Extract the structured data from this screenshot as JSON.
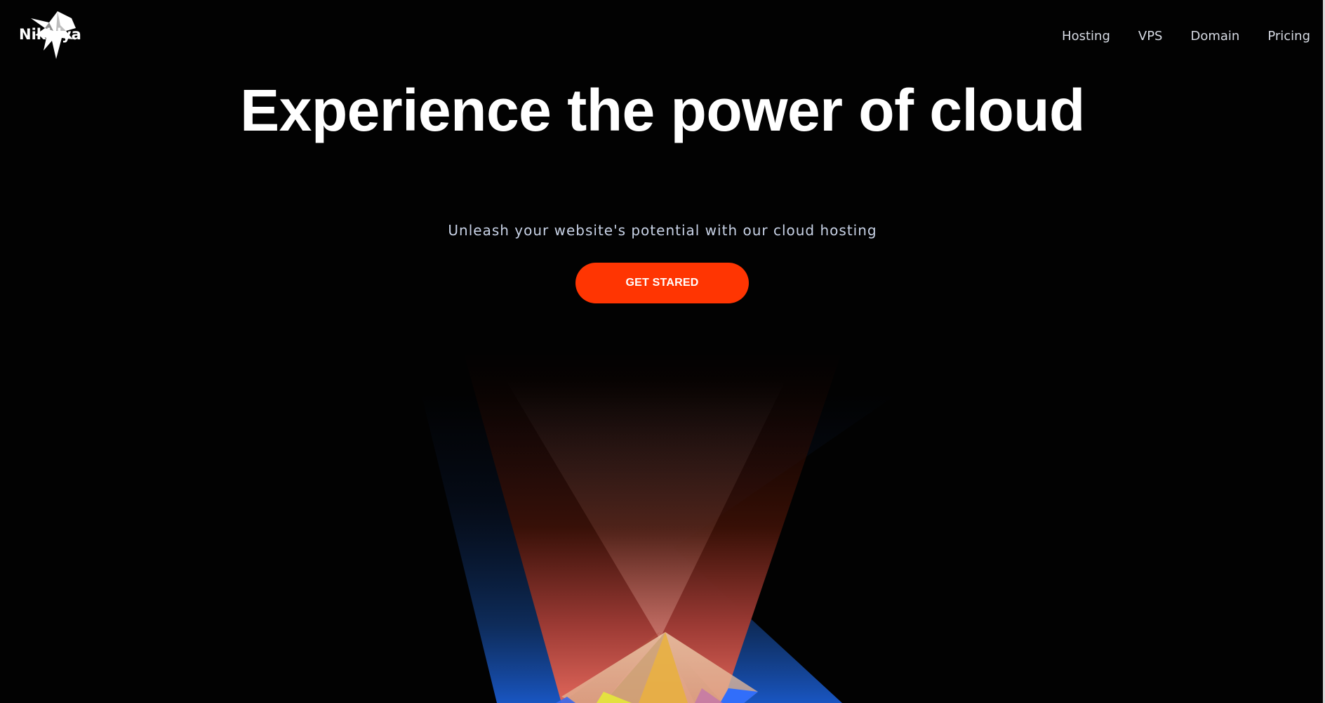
{
  "brand": {
    "name": "Nikhlya",
    "logo_icon": "star-burst-logo-icon"
  },
  "nav": {
    "items": [
      {
        "label": "Hosting"
      },
      {
        "label": "VPS"
      },
      {
        "label": "Domain"
      },
      {
        "label": "Pricing"
      }
    ]
  },
  "hero": {
    "title": "Experience the power of cloud",
    "subtitle": "Unleash your website's potential with our cloud hosting",
    "cta_label": "GET STARED"
  },
  "colors": {
    "background": "#020202",
    "accent": "#ff3502",
    "nav_text": "#d7dbe4",
    "subtitle_text": "#c8d2e6",
    "beam_red": "#e0442a",
    "beam_blue": "#1a6dff",
    "prism_yellow": "#ffd23c"
  }
}
